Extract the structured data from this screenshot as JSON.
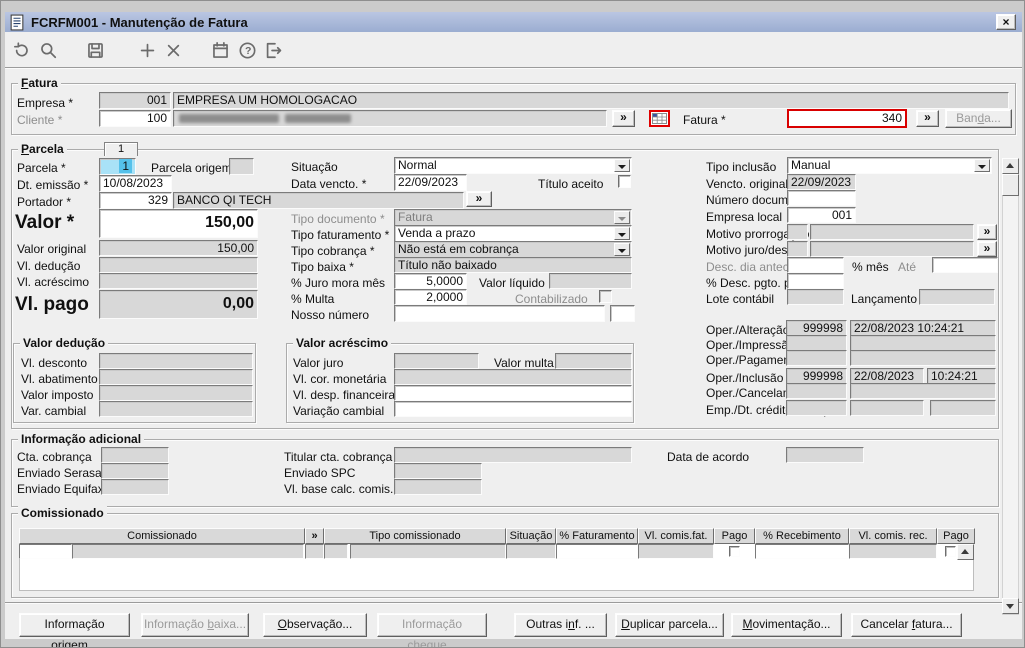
{
  "ui": {
    "zoom_label": "»",
    "close_label": "×",
    "help_glyph": "?"
  },
  "colors": {
    "titlebar_blue": "#A7B5D8",
    "red_highlight": "#D90000",
    "disabled_field_gray": "#D8D8D8",
    "selection_cyan": "#A9E2F7"
  },
  "window": {
    "title": "FCRFM001 - Manutenção de Fatura"
  },
  "toolbar": {
    "icons": [
      "reset",
      "search",
      "save",
      "add",
      "delete",
      "calendar",
      "help",
      "exit"
    ]
  },
  "fatura": {
    "legend_u": "F",
    "legend_rest": "atura",
    "empresa_label": "Empresa *",
    "empresa_code": "001",
    "empresa_name": "EMPRESA UM HOMOLOGACAO",
    "cliente_label": "Cliente *",
    "cliente_code": "100",
    "cliente_name_blurred": true,
    "fatura_label": "Fatura *",
    "fatura_value": "340",
    "banda_button": {
      "pre": "Ban",
      "u": "d",
      "post": "a..."
    }
  },
  "parcela": {
    "legend_u": "P",
    "legend_rest": "arcela",
    "tab": "1",
    "left": {
      "parcela_label": "Parcela *",
      "parcela_value": "1",
      "parcela_origem_label": "Parcela origem",
      "dt_emissao_label": "Dt. emissão *",
      "dt_emissao_value": "10/08/2023",
      "portador_label": "Portador *",
      "portador_code": "329",
      "portador_name": "BANCO QI TECH",
      "valor_label": "Valor *",
      "valor_value": "150,00",
      "valor_original_label": "Valor original",
      "valor_original_value": "150,00",
      "vl_deducao_label": "Vl. dedução",
      "vl_acrescimo_label": "Vl. acréscimo",
      "vl_pago_label": "Vl. pago",
      "vl_pago_value": "0,00"
    },
    "middle": {
      "situacao_label": "Situação",
      "situacao_value": "Normal",
      "data_vencto_label": "Data vencto. *",
      "data_vencto_value": "22/09/2023",
      "titulo_aceito_label": "Título aceito",
      "tipo_documento_label": "Tipo documento *",
      "tipo_documento_value": "Fatura",
      "tipo_faturamento_label": "Tipo faturamento *",
      "tipo_faturamento_value": "Venda a prazo",
      "tipo_cobranca_label": "Tipo cobrança *",
      "tipo_cobranca_value": "Não está em cobrança",
      "tipo_baixa_label": "Tipo baixa *",
      "tipo_baixa_value": "Título não baixado",
      "juro_mora_label": "% Juro mora mês",
      "juro_mora_value": "5,0000",
      "valor_liquido_label": "Valor líquido",
      "multa_label": "% Multa",
      "multa_value": "2,0000",
      "contabilizado_label": "Contabilizado",
      "nosso_numero_label": "Nosso número"
    },
    "right": {
      "tipo_inclusao_label": "Tipo inclusão",
      "tipo_inclusao_value": "Manual",
      "vencto_original_label": "Vencto. original",
      "vencto_original_value": "22/09/2023",
      "numero_documento_label": "Número documento",
      "empresa_local_label": "Empresa local",
      "empresa_local_value": "001",
      "motivo_prorrogacao_label": "Motivo prorrogação",
      "motivo_juro_desc_label": "Motivo juro/desc.",
      "desc_dia_antecip_label": "Desc. dia antecip.",
      "perc_mes_label": "% mês",
      "ate_label": "Até",
      "desc_pgto_prz_label": "% Desc. pgto. prz.",
      "lote_contabil_label": "Lote contábil",
      "lancamento_label": "Lançamento",
      "oper_alteracao_label": "Oper./Alteração",
      "oper_alteracao_user": "999998",
      "oper_alteracao_datetime": "22/08/2023 10:24:21",
      "oper_impressao_label": "Oper./Impressão",
      "oper_pagamento_label": "Oper./Pagamento",
      "oper_inclusao_label": "Oper./Inclusão",
      "oper_inclusao_user": "999998",
      "oper_inclusao_date": "22/08/2023",
      "oper_inclusao_time": "10:24:21",
      "oper_cancelamento_label": "Oper./Cancelamento",
      "emp_dt_credito_label": "Emp./Dt. crédito/Nr. liq."
    }
  },
  "valor_deducao": {
    "legend": "Valor dedução",
    "vl_desconto_label": "Vl. desconto",
    "vl_abatimento_label": "Vl. abatimento",
    "valor_imposto_label": "Valor imposto",
    "var_cambial_label": "Var. cambial"
  },
  "valor_acrescimo": {
    "legend": "Valor acréscimo",
    "valor_juro_label": "Valor juro",
    "valor_multa_label": "Valor multa",
    "vl_cor_monetaria_label": "Vl. cor. monetária",
    "vl_desp_financeira_label": "Vl. desp. financeira",
    "variacao_cambial_label": "Variação cambial"
  },
  "info_adicional": {
    "legend": "Informação adicional",
    "cta_cobranca_label": "Cta. cobrança",
    "titular_label": "Titular cta. cobrança",
    "data_acordo_label": "Data de acordo",
    "enviado_serasa_label": "Enviado Serasa",
    "enviado_spc_label": "Enviado SPC",
    "enviado_equifax_label": "Enviado Equifax",
    "vl_base_label": "Vl. base calc. comis."
  },
  "comissionado": {
    "legend": "Comissionado",
    "headers": [
      "Comissionado",
      "»",
      "Tipo comissionado",
      "Situação",
      "% Faturamento",
      "Vl. comis.fat.",
      "Pago",
      "% Recebimento",
      "Vl. comis. rec.",
      "Pago"
    ]
  },
  "footer_buttons": [
    {
      "pre": "Informação or",
      "u": "i",
      "post": "gem...",
      "enabled": true
    },
    {
      "pre": "Informação ",
      "u": "b",
      "post": "aixa...",
      "enabled": false
    },
    {
      "pre": "",
      "u": "O",
      "post": "bservação...",
      "enabled": true
    },
    {
      "pre": "Informação ",
      "u": "c",
      "post": "heque...",
      "enabled": false
    },
    {
      "pre": "Outras i",
      "u": "n",
      "post": "f. ...",
      "enabled": true
    },
    {
      "pre": "",
      "u": "D",
      "post": "uplicar parcela...",
      "enabled": true
    },
    {
      "pre": "",
      "u": "M",
      "post": "ovimentação...",
      "enabled": true
    },
    {
      "pre": "Cancelar ",
      "u": "f",
      "post": "atura...",
      "enabled": true
    }
  ]
}
